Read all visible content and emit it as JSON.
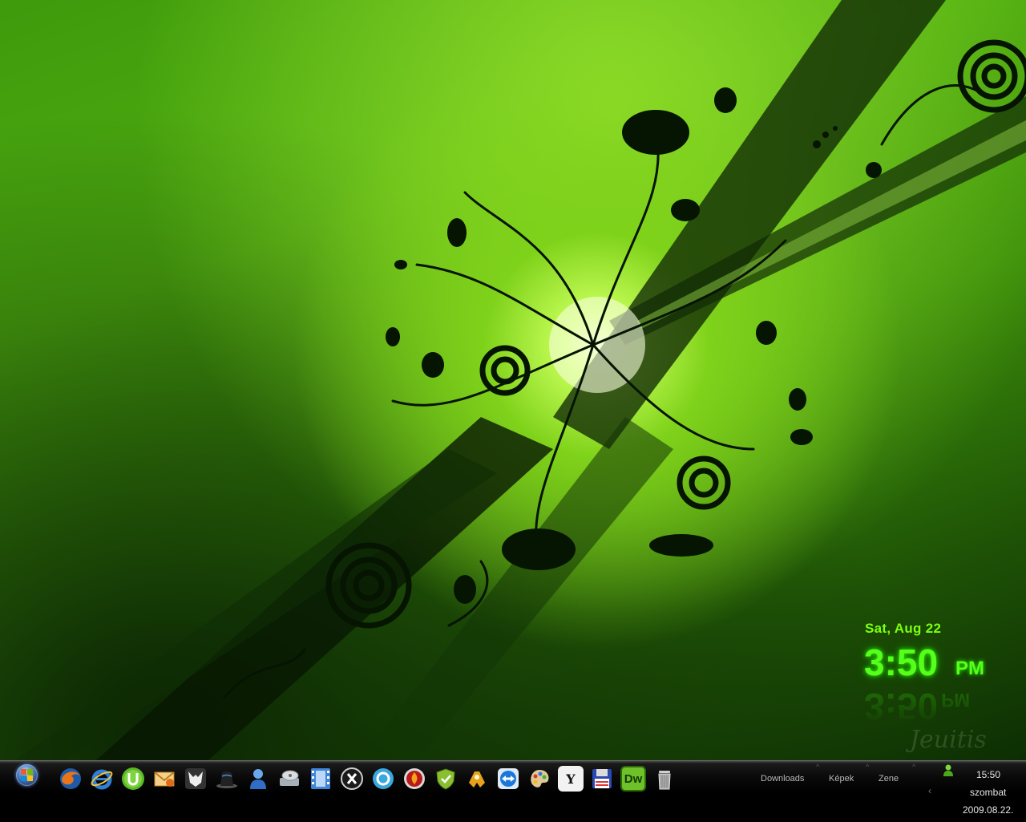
{
  "clock": {
    "date": "Sat, Aug 22",
    "time": "3:50",
    "ampm": "PM"
  },
  "signature": "Jeuitis",
  "taskbar": {
    "start_icon": "windows-logo",
    "dock_icons": [
      {
        "name": "firefox-icon",
        "color": "#e8751a"
      },
      {
        "name": "internet-explorer-icon",
        "color": "#2f7fd8"
      },
      {
        "name": "utorrent-icon",
        "color": "#5cb82a"
      },
      {
        "name": "mail-icon",
        "color": "#e0a030"
      },
      {
        "name": "foobar-icon",
        "color": "#dddddd"
      },
      {
        "name": "black-hat-icon",
        "color": "#2a2a2a"
      },
      {
        "name": "messenger-icon",
        "color": "#4a8ad8"
      },
      {
        "name": "disk-drive-icon",
        "color": "#9aa6b0"
      },
      {
        "name": "film-icon",
        "color": "#3f86d8"
      },
      {
        "name": "x-close-icon",
        "color": "#d8d8d8"
      },
      {
        "name": "orb-icon",
        "color": "#3aa8e0"
      },
      {
        "name": "flame-icon",
        "color": "#d83a1a"
      },
      {
        "name": "shield-icon",
        "color": "#8ac030"
      },
      {
        "name": "gamepad-icon",
        "color": "#e6a21a"
      },
      {
        "name": "teamviewer-icon",
        "color": "#1a78d8"
      },
      {
        "name": "palette-icon",
        "color": "#d8b070"
      },
      {
        "name": "yahoo-icon",
        "color": "#f2f2f2"
      },
      {
        "name": "floppy-disk-icon",
        "color": "#2a4ab0"
      },
      {
        "name": "dreamweaver-icon",
        "color": "#6fc12a"
      },
      {
        "name": "trash-icon",
        "color": "#b8b8b8"
      }
    ],
    "dock_labels": {
      "yahoo": "Y",
      "dreamweaver": "Dw"
    },
    "folders": [
      "Downloads",
      "Képek",
      "Zene"
    ],
    "tray": {
      "time": "15:50",
      "day": "szombat",
      "date": "2009.08.22."
    },
    "colors": {
      "accent_green": "#57ff1c",
      "taskbar_bg": "#000000"
    }
  }
}
